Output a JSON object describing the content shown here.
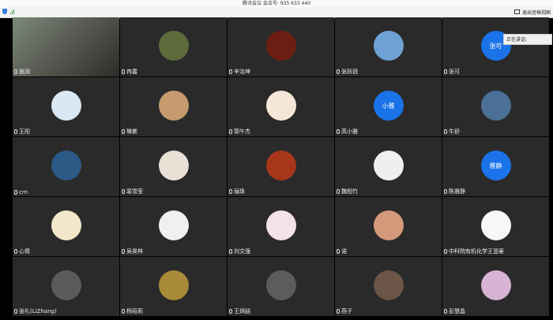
{
  "window": {
    "title": "腾讯会议 会议号: 935 633 440"
  },
  "toolbar": {
    "gallery_label": "退出宫格视图"
  },
  "speaking": {
    "label": "正在讲话:"
  },
  "participants": [
    {
      "name": "施润",
      "avatar": "video",
      "color": "#7a7a6a"
    },
    {
      "name": "冉露",
      "avatar": "image",
      "color": "#5d6a3a"
    },
    {
      "name": "辛治坤",
      "avatar": "image",
      "color": "#6d1e12"
    },
    {
      "name": "张跃锐",
      "avatar": "image",
      "color": "#6fa2d4"
    },
    {
      "name": "张可",
      "avatar": "text",
      "avatar_text": "张可",
      "color": "#1a73e8"
    },
    {
      "name": "王阳",
      "avatar": "image",
      "color": "#d9e8f3"
    },
    {
      "name": "琳紫",
      "avatar": "image",
      "color": "#c69a6d"
    },
    {
      "name": "郭午杰",
      "avatar": "image",
      "color": "#f4e7d7"
    },
    {
      "name": "高小雅",
      "avatar": "text",
      "avatar_text": "小雅",
      "color": "#1a73e8"
    },
    {
      "name": "牛舒",
      "avatar": "image",
      "color": "#4b6f96"
    },
    {
      "name": "crn",
      "avatar": "image",
      "color": "#2a5a85"
    },
    {
      "name": "裴雪莹",
      "avatar": "image",
      "color": "#e9e0d6"
    },
    {
      "name": "骊珠",
      "avatar": "image",
      "color": "#a7361b"
    },
    {
      "name": "魏相竹",
      "avatar": "image",
      "color": "#efefef"
    },
    {
      "name": "陈雅静",
      "avatar": "text",
      "avatar_text": "雅静",
      "color": "#1a73e8"
    },
    {
      "name": "心情",
      "avatar": "image",
      "color": "#f2e7c8"
    },
    {
      "name": "吴昊林",
      "avatar": "image",
      "color": "#f0f0f0"
    },
    {
      "name": "刘文强",
      "avatar": "image",
      "color": "#f4e3e6"
    },
    {
      "name": "诺",
      "avatar": "image",
      "color": "#d29a7a"
    },
    {
      "name": "中科院有机化学王翌豪",
      "avatar": "image",
      "color": "#f7f7f7"
    },
    {
      "name": "张礼(LiZhang)",
      "avatar": "image",
      "color": "#5b5b5b"
    },
    {
      "name": "杨昭莉",
      "avatar": "image",
      "color": "#a88a39"
    },
    {
      "name": "王炳喆",
      "avatar": "image",
      "color": "#5c5c5c"
    },
    {
      "name": "燕子",
      "avatar": "image",
      "color": "#6a5546"
    },
    {
      "name": "彭慧晶",
      "avatar": "image",
      "color": "#d7b3d4"
    }
  ]
}
